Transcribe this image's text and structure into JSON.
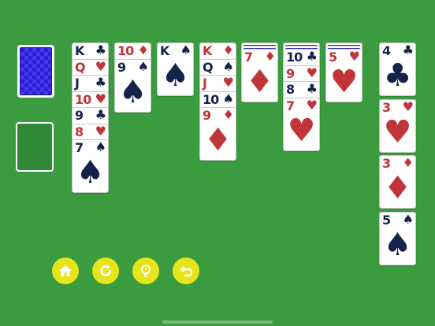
{
  "suits": {
    "spade": "♠",
    "heart": "♥",
    "diamond": "♦",
    "club": "♣"
  },
  "colors": {
    "table": "#3a9b3f",
    "red_suit": "#c0353a",
    "black_suit": "#14234a",
    "card_back": "#2a1fe0",
    "button": "#e6e41a"
  },
  "tableau": [
    [
      {
        "rank": "K",
        "suit": "♣"
      },
      {
        "rank": "Q",
        "suit": "♥"
      },
      {
        "rank": "J",
        "suit": "♣"
      },
      {
        "rank": "10",
        "suit": "♥"
      },
      {
        "rank": "9",
        "suit": "♣"
      },
      {
        "rank": "8",
        "suit": "♥"
      },
      {
        "rank": "7",
        "suit": "♠"
      }
    ],
    [
      {
        "rank": "10",
        "suit": "♦"
      },
      {
        "rank": "9",
        "suit": "♠"
      }
    ],
    [
      {
        "rank": "K",
        "suit": "♠"
      }
    ],
    [
      {
        "rank": "K",
        "suit": "♦"
      },
      {
        "rank": "Q",
        "suit": "♠"
      },
      {
        "rank": "J",
        "suit": "♥"
      },
      {
        "rank": "10",
        "suit": "♠"
      },
      {
        "rank": "9",
        "suit": "♦"
      }
    ],
    [
      {
        "rank": "7",
        "suit": "♦"
      }
    ],
    [
      {
        "rank": "10",
        "suit": "♣"
      },
      {
        "rank": "9",
        "suit": "♥"
      },
      {
        "rank": "8",
        "suit": "♣"
      },
      {
        "rank": "7",
        "suit": "♥"
      }
    ],
    [
      {
        "rank": "5",
        "suit": "♥"
      }
    ]
  ],
  "foundations": [
    {
      "rank": "4",
      "suit": "♣"
    },
    {
      "rank": "3",
      "suit": "♥"
    },
    {
      "rank": "3",
      "suit": "♦"
    },
    {
      "rank": "5",
      "suit": "♠"
    }
  ],
  "controls": [
    {
      "name": "home-button",
      "icon": "home-icon"
    },
    {
      "name": "restart-button",
      "icon": "refresh-icon"
    },
    {
      "name": "hint-button",
      "icon": "lightbulb-icon"
    },
    {
      "name": "undo-button",
      "icon": "undo-icon"
    }
  ]
}
